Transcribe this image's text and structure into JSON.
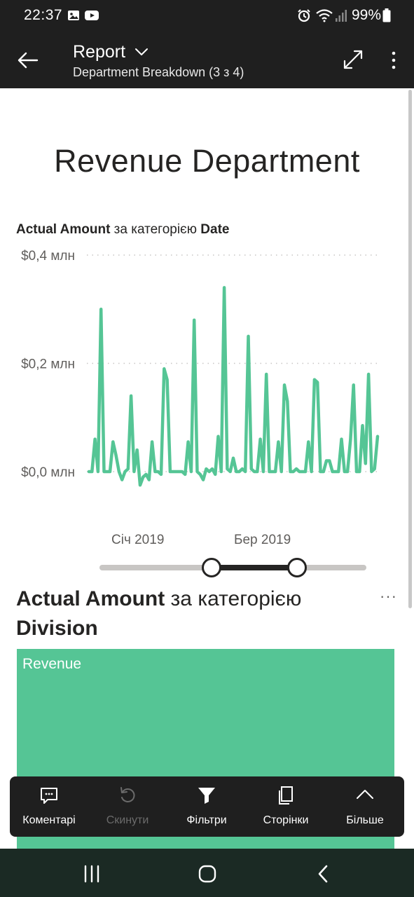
{
  "status_bar": {
    "time": "22:37",
    "battery_percent": "99%",
    "icons": [
      "image-icon",
      "youtube-icon",
      "alarm-icon",
      "wifi-icon",
      "signal-icon",
      "battery-icon"
    ]
  },
  "header": {
    "title": "Report",
    "subtitle": "Department Breakdown (3 з 4)"
  },
  "page": {
    "title": "Revenue Department"
  },
  "line_chart": {
    "title_measure": "Actual Amount",
    "title_mid": " за категорією ",
    "title_dimension": "Date",
    "y_ticks": [
      "$0,4 млн",
      "$0,2 млн",
      "$0,0 млн"
    ],
    "x_ticks": [
      "Січ 2019",
      "Бер 2019"
    ],
    "line_color": "#55c595"
  },
  "chart_data": {
    "type": "line",
    "title": "Actual Amount за категорією Date",
    "y_tick_labels": [
      "$0,4 млн",
      "$0,2 млн",
      "$0,0 млн"
    ],
    "x_tick_labels": [
      "Січ 2019",
      "Бер 2019"
    ],
    "ylim": [
      0,
      0.4
    ],
    "grid": true,
    "series": [
      {
        "values": [
          0.0,
          0.0,
          0.06,
          0.0,
          0.3,
          0.0,
          0.0,
          0.0,
          0.055,
          0.03,
          0.0,
          -0.015,
          0.0,
          0.005,
          0.14,
          0.0,
          0.04,
          -0.025,
          -0.01,
          -0.005,
          -0.015,
          0.055,
          0.0,
          0.0,
          -0.005,
          0.19,
          0.17,
          0.0,
          0.0,
          0.0,
          0.0,
          0.0,
          -0.005,
          0.055,
          0.0,
          0.28,
          0.0,
          -0.005,
          -0.015,
          0.005,
          0.0,
          0.005,
          -0.005,
          0.065,
          0.0,
          0.34,
          0.005,
          0.0,
          0.025,
          0.0,
          0.0,
          0.005,
          0.0,
          0.25,
          0.005,
          0.0,
          0.0,
          0.06,
          0.0,
          0.18,
          0.0,
          0.0,
          0.0,
          0.055,
          0.0,
          0.16,
          0.13,
          0.0,
          0.0,
          0.005,
          0.0,
          0.0,
          0.0,
          0.055,
          0.0,
          0.17,
          0.165,
          0.0,
          0.0,
          0.02,
          0.02,
          0.0,
          0.0,
          0.0,
          0.06,
          0.0,
          0.0,
          0.06,
          0.16,
          0.0,
          0.0,
          0.085,
          0.015,
          0.18,
          0.0,
          0.005,
          0.065
        ]
      }
    ]
  },
  "date_slider": {
    "range_start": 0.42,
    "range_end": 0.74
  },
  "division_visual": {
    "title_measure": "Actual Amount",
    "title_mid": " за категорією ",
    "title_dimension": "Division",
    "more_label": "···",
    "treemap_items": [
      {
        "label": "Revenue",
        "color": "#55c595"
      }
    ]
  },
  "action_bar": {
    "items": [
      {
        "label": "Коментарі",
        "icon": "comment-icon",
        "enabled": true
      },
      {
        "label": "Скинути",
        "icon": "reset-icon",
        "enabled": false
      },
      {
        "label": "Фільтри",
        "icon": "filter-icon",
        "enabled": true
      },
      {
        "label": "Сторінки",
        "icon": "pages-icon",
        "enabled": true
      },
      {
        "label": "Більше",
        "icon": "chevron-up-icon",
        "enabled": true
      }
    ]
  },
  "nav_bar": {
    "buttons": [
      "recent-apps-icon",
      "home-icon",
      "back-nav-icon"
    ]
  }
}
